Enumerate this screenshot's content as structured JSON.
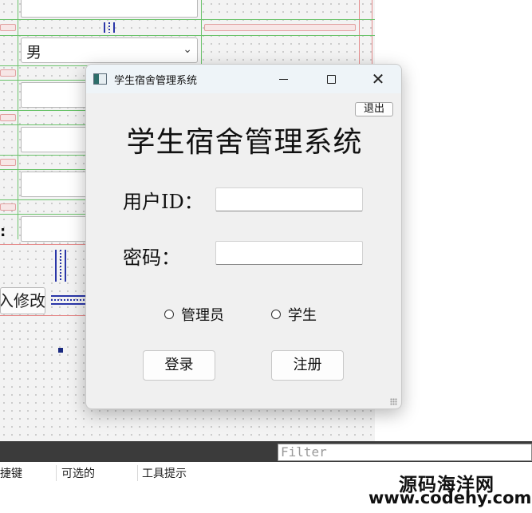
{
  "designer": {
    "combo_value": "男",
    "button_fragment": "入修改",
    "trailing_colon": ":"
  },
  "bottom_panel": {
    "filter_placeholder": "Filter",
    "columns": [
      "捷键",
      "可选的",
      "工具提示"
    ]
  },
  "watermark": {
    "line1": "源码海洋网",
    "line2": "www.codehy.com"
  },
  "dialog": {
    "window_title": "学生宿舍管理系统",
    "exit_label": "退出",
    "heading": "学生宿舍管理系统",
    "user_id_label": "用户ID：",
    "password_label": "密码：",
    "radios": [
      {
        "label": "管理员",
        "checked": false
      },
      {
        "label": "学生",
        "checked": false
      }
    ],
    "login_label": "登录",
    "register_label": "注册",
    "icons": {
      "app": "app-icon",
      "minimize": "minimize-icon",
      "maximize": "maximize-icon",
      "close": "close-icon"
    }
  }
}
